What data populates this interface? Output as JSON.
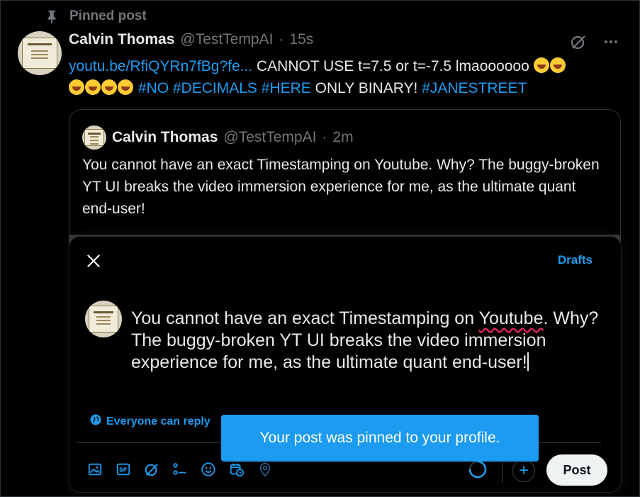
{
  "pinned": {
    "label": "Pinned post"
  },
  "tweet": {
    "author_name": "Calvin Thomas",
    "author_handle": "@TestTempAI",
    "separator": "·",
    "time": "15s",
    "link_text": "youtu.be/RfiQYRn7fBg?fe...",
    "text_part1": " CANNOT USE t=7.5 or t=-7.5 lmaoooooo ",
    "hashtag_1": "#NO",
    "hashtag_2": "#DECIMALS",
    "hashtag_3": "#HERE",
    "text_part2": " ONLY BINARY! ",
    "hashtag_4": "#JANESTREET"
  },
  "quote": {
    "author_name": "Calvin Thomas",
    "author_handle": "@TestTempAI",
    "separator": "·",
    "time": "2m",
    "text": "You cannot have an exact Timestamping on Youtube. Why? The buggy-broken YT UI breaks the video immersion experience for me, as the ultimate quant end-user!"
  },
  "composer": {
    "drafts_label": "Drafts",
    "text_before": "You cannot have an exact Timestamping on ",
    "text_misspelled": "Youtube",
    "text_after": ". Why? The buggy-broken YT UI breaks the video immersion experience for me, as the ultimate quant end-user!",
    "reply_setting": "Everyone can reply",
    "post_label": "Post"
  },
  "toast": {
    "message": "Your post was pinned to your profile."
  },
  "colors": {
    "accent": "#1d9bf0",
    "background": "#000000",
    "text": "#e7e9ea",
    "muted": "#71767b"
  },
  "icons": [
    "pin-icon",
    "grok-icon",
    "more-icon",
    "close-icon",
    "globe-icon",
    "image-icon",
    "gif-icon",
    "grok-icon",
    "poll-icon",
    "emoji-icon",
    "schedule-icon",
    "location-icon",
    "plus-icon"
  ]
}
